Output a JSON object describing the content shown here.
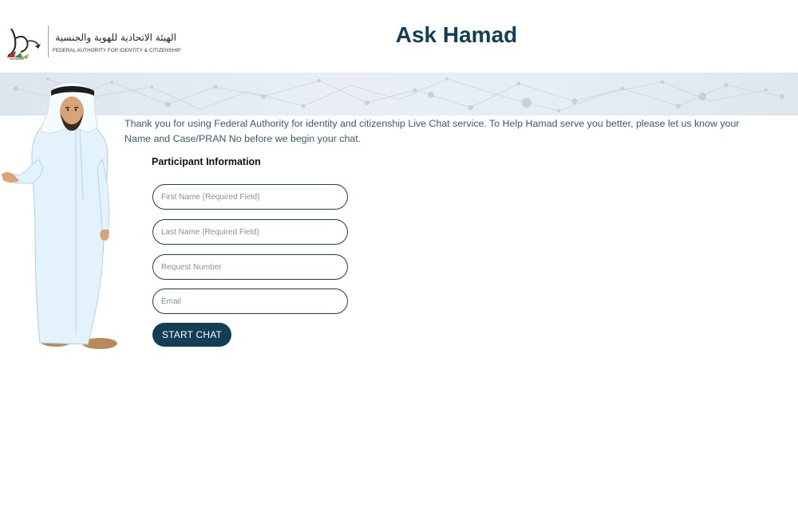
{
  "header": {
    "logo_arabic": "الهيئة الاتحادية للهوية والجنسية",
    "logo_english": "FEDERAL AUTHORITY FOR IDENTITY & CITIZENSHIP",
    "title": "Ask Hamad"
  },
  "intro_text": "Thank you for using Federal Authority for identity and citizenship Live Chat service. To Help Hamad serve you better, please let us know your Name and Case/PRAN No before we begin your chat.",
  "form": {
    "heading": "Participant Information",
    "fields": [
      {
        "placeholder": "First Name (Required Field)",
        "value": ""
      },
      {
        "placeholder": "Last Name (Required Field)",
        "value": ""
      },
      {
        "placeholder": "Request Number",
        "value": ""
      },
      {
        "placeholder": "Email",
        "value": ""
      }
    ],
    "submit_label": "START CHAT"
  },
  "colors": {
    "brand_dark": "#123e55",
    "field_border": "#1c3f52",
    "intro_text": "#3a5a6e",
    "banner": "#e3ebf2"
  },
  "icons": {
    "logo": "falcon-emblem",
    "avatar": "hamad-character"
  }
}
